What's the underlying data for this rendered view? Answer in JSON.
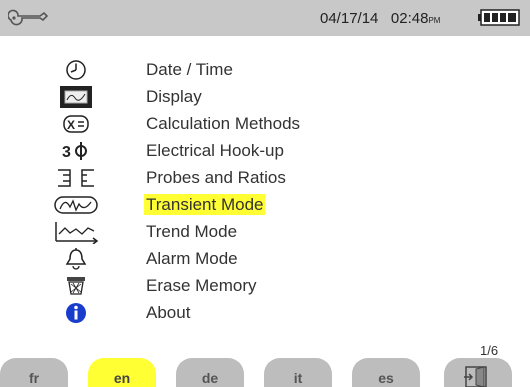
{
  "header": {
    "date": "04/17/14",
    "time": "02:48",
    "ampm": "PM",
    "battery_level": 1.0,
    "tool_icon": "wrench-icon",
    "battery_icon": "battery-icon"
  },
  "menu": {
    "items": [
      {
        "label": "Date / Time",
        "icon": "clock-icon"
      },
      {
        "label": "Display",
        "icon": "display-icon"
      },
      {
        "label": "Calculation Methods",
        "icon": "calculation-icon"
      },
      {
        "label": "Electrical Hook-up",
        "icon": "three-phase-icon"
      },
      {
        "label": "Probes and Ratios",
        "icon": "probes-icon"
      },
      {
        "label": "Transient Mode",
        "icon": "transient-icon"
      },
      {
        "label": "Trend Mode",
        "icon": "trend-icon"
      },
      {
        "label": "Alarm Mode",
        "icon": "alarm-bell-icon"
      },
      {
        "label": "Erase Memory",
        "icon": "erase-bin-icon"
      },
      {
        "label": "About",
        "icon": "info-icon"
      }
    ],
    "selected_index": 5
  },
  "pagination": {
    "label": "1/6"
  },
  "tabs": [
    {
      "label": "fr"
    },
    {
      "label": "en"
    },
    {
      "label": "de"
    },
    {
      "label": "it"
    },
    {
      "label": "es"
    }
  ],
  "active_tab_index": 1,
  "exit_icon": "exit-door-icon",
  "colors": {
    "header_bg": "#c8c8c8",
    "highlight": "#ffff33",
    "tab_bg": "#bdbdbd",
    "info_blue": "#1a3ccc"
  }
}
